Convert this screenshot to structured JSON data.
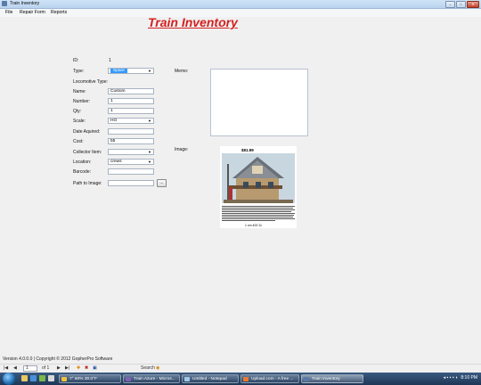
{
  "window": {
    "title": "Train Inventory"
  },
  "menu": [
    "File",
    "Repair Form",
    "Reports"
  ],
  "heading": "Train Inventory",
  "form": {
    "id_label": "ID:",
    "id_value": "1",
    "type_label": "Type:",
    "type_value": "Spare",
    "loco_label": "Locomotive Type:",
    "name_label": "Name:",
    "name_value": "Custom",
    "number_label": "Number:",
    "number_value": "1",
    "qty_label": "Qty:",
    "qty_value": "1",
    "scale_label": "Scale:",
    "scale_value": "HO",
    "date_label": "Date Aquired:",
    "date_value": "",
    "cost_label": "Cost:",
    "cost_value": "55",
    "collector_label": "Collector Item:",
    "collector_value": "",
    "location_label": "Location:",
    "location_value": "crews",
    "barcode_label": "Barcode:",
    "barcode_value": "",
    "path_label": "Path to Image:",
    "path_value": "",
    "browse_label": "...",
    "memo_label": "Memo:",
    "image_label": "Image:"
  },
  "image": {
    "price": "$81.99",
    "caption": "1 cm 400 11"
  },
  "status": "Version 4.0.0.0  |  Copyright © 2012 GopherPro Software",
  "navigator": {
    "position": "1",
    "of_label": "of 1",
    "search_label": "Search"
  },
  "taskbar": {
    "items": [
      "7° 60% 30.0°F",
      "Train Azure - Micros...",
      "Untitled - Notepad",
      "Upload.com - A free ...",
      "Train Inventory"
    ],
    "clock": "8:10 PM"
  },
  "colors": {
    "accent": "#d42020",
    "taskbar": "#1e3656"
  }
}
